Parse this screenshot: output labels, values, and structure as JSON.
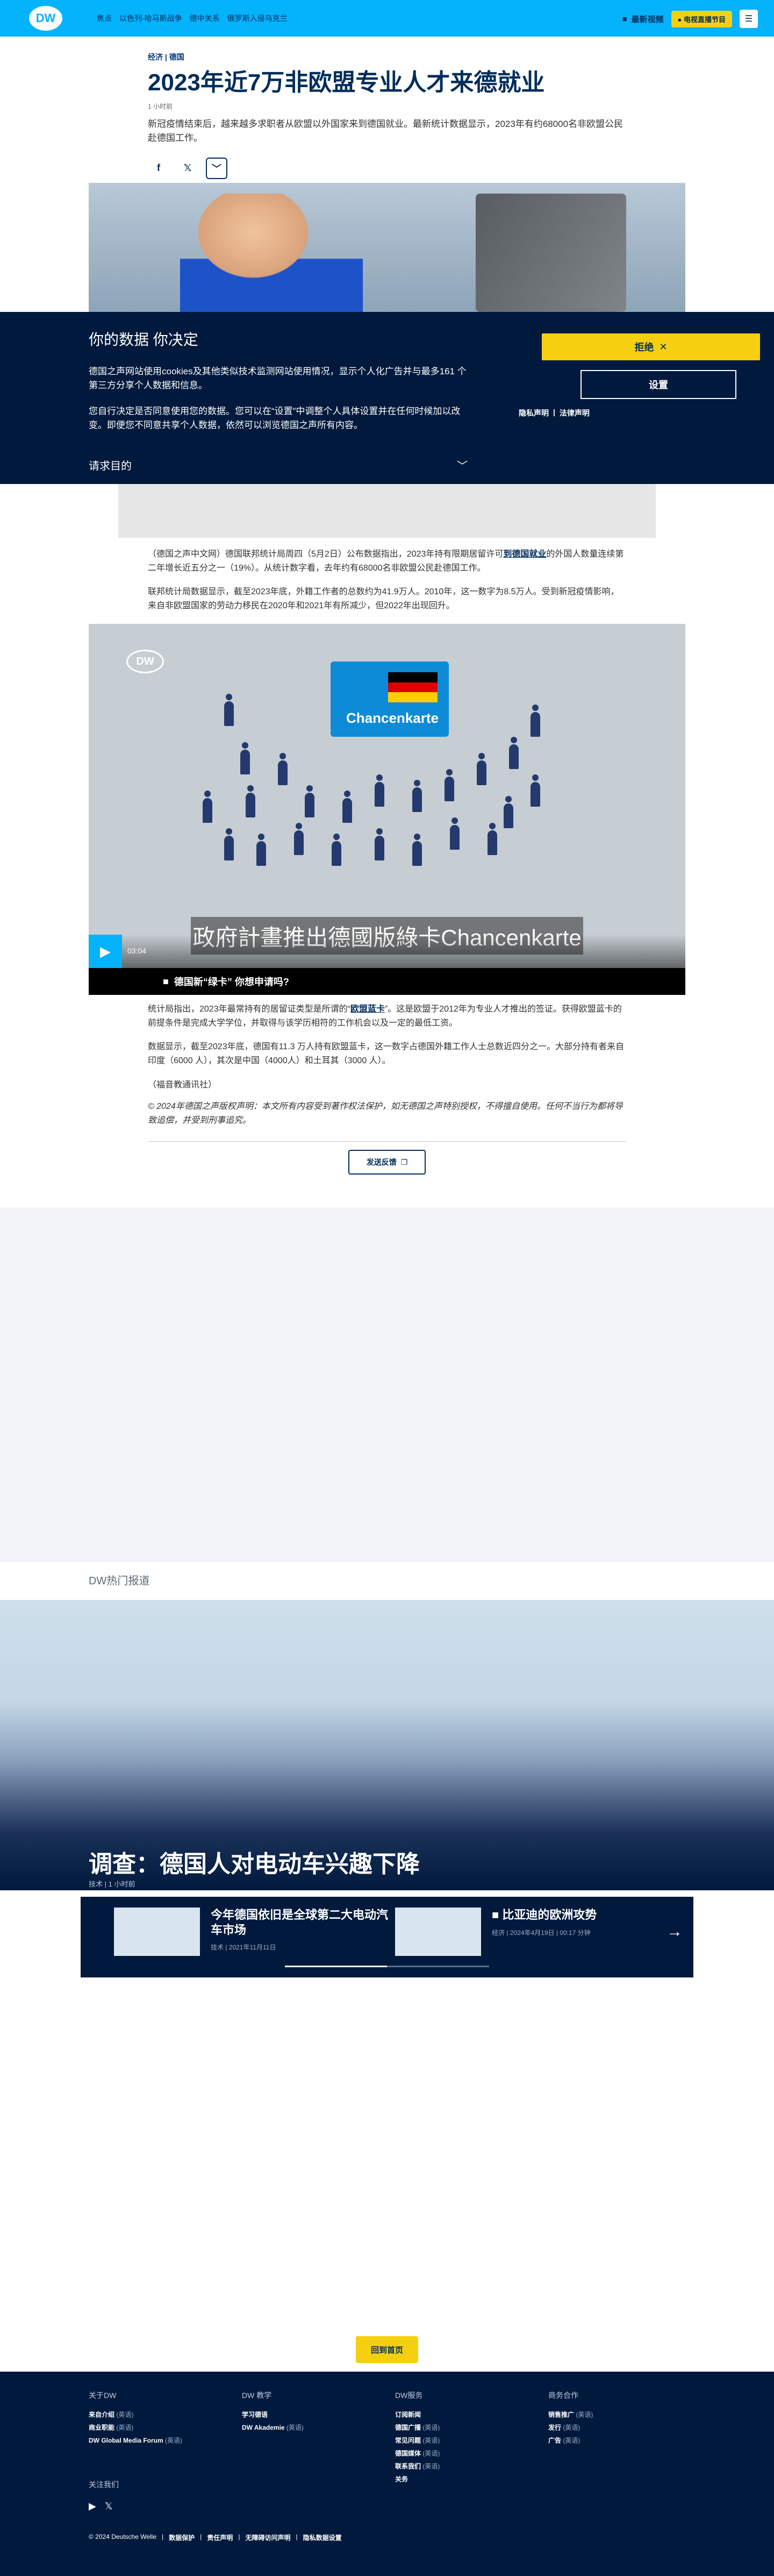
{
  "header": {
    "logo": "DW",
    "nav": [
      "焦点",
      "以色列-哈马斯战争",
      "德中关系",
      "俄罗斯入侵乌克兰"
    ],
    "newest_video": "最新视频",
    "live": "● 电视直播节目",
    "menu_icon": "menu-icon"
  },
  "article": {
    "breadcrumb": "经济 | 德国",
    "title": "2023年近7万非欧盟专业人才来德就业",
    "time": "1 小时前",
    "lead": "新冠疫情结束后，越来越多求职者从欧盟以外国家来到德国就业。最新统计数据显示，2023年有约68000名非欧盟公民赴德国工作。",
    "share": {
      "facebook": "f",
      "x": "𝕏",
      "more": "﹀"
    }
  },
  "cookie": {
    "title": "你的数据 你决定",
    "p1": "德国之声网站使用cookies及其他类似技术监测网站使用情况，显示个人化广告并与最多161 个第三方分享个人数据和信息。",
    "p2": "您自行决定是否同意使用您的数据。您可以在“设置”中调整个人具体设置并在任何时候加以改变。即便您不同意共享个人数据，依然可以浏览德国之声所有内容。",
    "purposes": "请求目的",
    "decline": "拒绝",
    "settings": "设置",
    "privacy": "隐私声明",
    "legal": "法律声明"
  },
  "body": {
    "p1_pre": "（德国之声中文网）德国联邦统计局周四（5月2日）公布数据指出，2023年持有限期居留许可",
    "p1_link": "到德国就业",
    "p1_post": "的外国人数量连续第二年增长近五分之一（19%）。从统计数字看，去年约有68000名非欧盟公民赴德国工作。",
    "p2": "联邦统计局数据显示，截至2023年底，外籍工作者的总数约为41.9万人。2010年，这一数字为8.5万人。受到新冠疫情影响，来自非欧盟国家的劳动力移民在2020年和2021年有所减少，但2022年出现回升。",
    "p3_pre": "统计局指出，2023年最常持有的居留证类型是所谓的“",
    "p3_link": "欧盟蓝卡",
    "p3_post": "”。这是欧盟于2012年为专业人才推出的签证。获得欧盟蓝卡的前提条件是完成大学学位，并取得与该学历相符的工作机会以及一定的最低工资。",
    "p4": "数据显示，截至2023年底，德国有11.3 万人持有欧盟蓝卡，这一数字占德国外籍工作人士总数近四分之一。大部分持有者来自印度（6000 人），其次是中国（4000人）和土耳其（3000 人）。",
    "p5": "（福音教通讯社）",
    "copyright": "© 2024年德国之声版权声明：本文所有内容受到著作权法保护，如无德国之声特别授权，不得擅自使用。任何不当行为都将导致追偿，并受到刑事追究。"
  },
  "video": {
    "logo": "DW",
    "card_label": "Chancenkarte",
    "subtitle": "政府計畫推出德國版綠卡Chancenkarte",
    "duration": "03:04",
    "caption": "德国新“绿卡” 你想申请吗?"
  },
  "feedback": "发送反馈",
  "hot": {
    "label": "DW热门报道",
    "headline": "调查：德国人对电动车兴趣下降",
    "meta": "技术 | 1 小时前",
    "items": [
      {
        "title": "今年德国依旧是全球第二大电动汽车市场",
        "meta": "技术 | 2021年11月11日"
      },
      {
        "title": "比亚迪的欧洲攻势",
        "meta": "经济 | 2024年4月19日 | 00:17 分钟"
      }
    ]
  },
  "back_home": "回到首页",
  "footer": {
    "cols": [
      {
        "head": "关于DW",
        "items": [
          {
            "label": "来自介绍",
            "note": "(英语)"
          },
          {
            "label": "商业职能",
            "note": "(英语)"
          },
          {
            "label": "DW Global Media Forum",
            "note": "(英语)"
          }
        ]
      },
      {
        "head": "DW 教学",
        "items": [
          {
            "label": "学习德语",
            "note": ""
          },
          {
            "label": "DW Akademie",
            "note": "(英语)"
          }
        ]
      },
      {
        "head": "DW服务",
        "items": [
          {
            "label": "订阅新闻",
            "note": ""
          },
          {
            "label": "德国广播",
            "note": "(英语)"
          },
          {
            "label": "常见问题",
            "note": "(英语)"
          },
          {
            "label": "德国媒体",
            "note": "(英语)"
          },
          {
            "label": "联系我们",
            "note": "(英语)"
          },
          {
            "label": "关务",
            "note": ""
          }
        ]
      },
      {
        "head": "商务合作",
        "items": [
          {
            "label": "销售推广",
            "note": "(英语)"
          },
          {
            "label": "发行",
            "note": "(英语)"
          },
          {
            "label": "广告",
            "note": "(英语)"
          }
        ]
      }
    ],
    "follow": "关注我们",
    "bottom": [
      "© 2024 Deutsche Welle",
      "数据保护",
      "责任声明",
      "无障碍访问声明",
      "隐私数据设置"
    ]
  },
  "colors": {
    "brand": "#05b2fc",
    "navy": "#00193c",
    "accent": "#f5d010"
  }
}
